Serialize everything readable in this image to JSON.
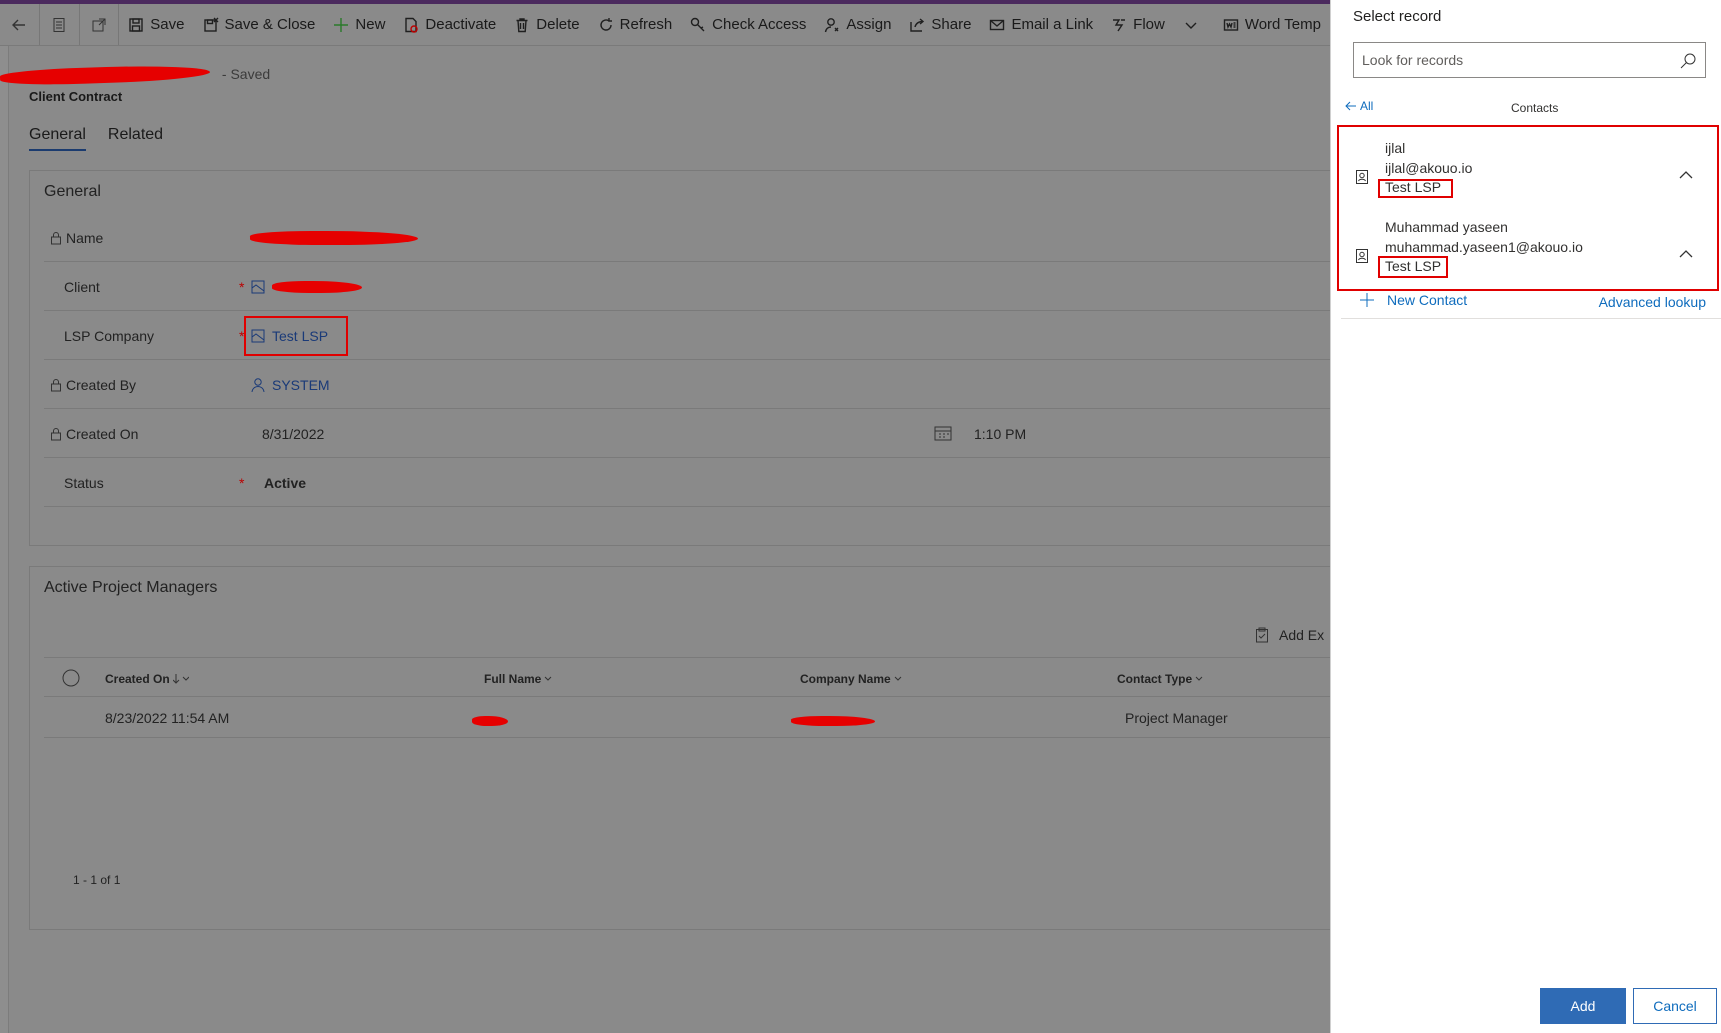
{
  "commandbar": {
    "items": [
      {
        "label": "Save",
        "icon": "save-icon"
      },
      {
        "label": "Save & Close",
        "icon": "save-close-icon"
      },
      {
        "label": "New",
        "icon": "plus-icon"
      },
      {
        "label": "Deactivate",
        "icon": "deactivate-icon"
      },
      {
        "label": "Delete",
        "icon": "trash-icon"
      },
      {
        "label": "Refresh",
        "icon": "refresh-icon"
      },
      {
        "label": "Check Access",
        "icon": "key-icon"
      },
      {
        "label": "Assign",
        "icon": "person-icon"
      },
      {
        "label": "Share",
        "icon": "share-icon"
      },
      {
        "label": "Email a Link",
        "icon": "mail-icon"
      },
      {
        "label": "Flow",
        "icon": "flow-icon"
      },
      {
        "label": "Word Temp",
        "icon": "word-icon"
      }
    ]
  },
  "record": {
    "status_suffix": "- Saved",
    "entity": "Client Contract"
  },
  "tabs": {
    "general": "General",
    "related": "Related"
  },
  "general_section": {
    "title": "General",
    "fields": {
      "name_label": "Name",
      "client_label": "Client",
      "lsp_label": "LSP Company",
      "lsp_value": "Test LSP",
      "created_by_label": "Created By",
      "created_by_value": "SYSTEM",
      "created_on_label": "Created On",
      "created_on_date": "8/31/2022",
      "created_on_time": "1:10 PM",
      "status_label": "Status",
      "status_value": "Active",
      "required_mark": "*"
    }
  },
  "pm_section": {
    "title": "Active Project Managers",
    "add_existing": "Add Ex",
    "columns": [
      "Created On",
      "Full Name",
      "Company Name",
      "Contact Type"
    ],
    "rows": [
      {
        "created_on": "8/23/2022 11:54 AM",
        "contact_type": "Project Manager"
      }
    ],
    "pagination": "1 - 1 of 1"
  },
  "lookup_panel": {
    "title": "Select record",
    "search_placeholder": "Look for records",
    "back_label": "All",
    "entity_label": "Contacts",
    "results": [
      {
        "name": "ijlal",
        "email": "ijlal@akouo.io",
        "company": "Test LSP"
      },
      {
        "name": "Muhammad yaseen",
        "email": "muhammad.yaseen1@akouo.io",
        "company": "Test LSP"
      }
    ],
    "new_contact": "New Contact",
    "advanced_lookup": "Advanced lookup",
    "add_button": "Add",
    "cancel_button": "Cancel"
  },
  "colors": {
    "accent": "#2f6bb5",
    "highlight": "#e00000",
    "link": "#0f6cbd"
  }
}
